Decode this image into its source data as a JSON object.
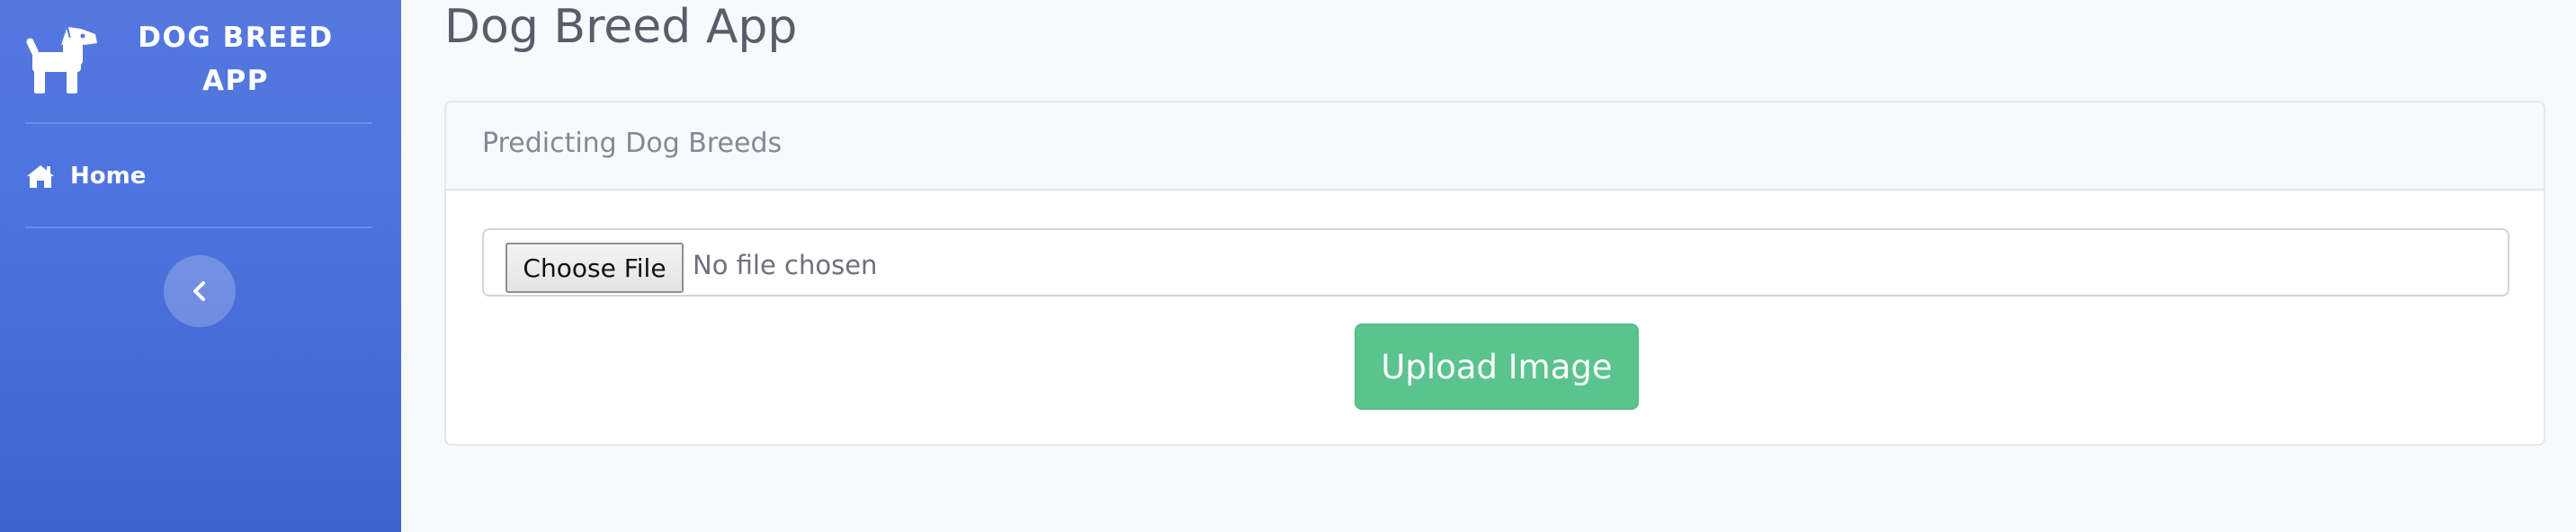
{
  "sidebar": {
    "brand_text": "DOG BREED APP",
    "brand_icon": "dog-icon",
    "nav": [
      {
        "label": "Home",
        "icon": "home-icon"
      }
    ],
    "toggle_icon": "chevron-left-icon"
  },
  "main": {
    "page_title": "Dog Breed App",
    "card": {
      "header": "Predicting Dog Breeds",
      "file_input": {
        "button_label": "Choose File",
        "status": "No file chosen"
      },
      "upload_button_label": "Upload Image"
    }
  },
  "colors": {
    "sidebar": "#4e73df",
    "success": "#5bc48e",
    "page_bg": "#f8f9fc",
    "title_text": "#5a5c69"
  }
}
